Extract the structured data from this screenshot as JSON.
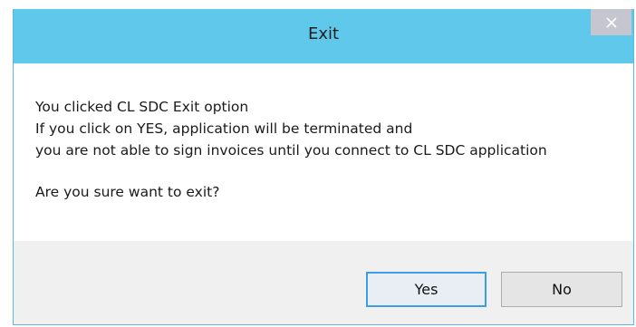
{
  "window": {
    "title": "Exit",
    "close_symbol": "close-icon"
  },
  "message": {
    "line1": "You clicked CL SDC Exit option",
    "line2": "If you click on YES, application will be terminated and",
    "line3": "you are not able to sign invoices until you connect to CL SDC application",
    "question": "Are you sure want to exit?"
  },
  "buttons": {
    "yes_label": "Yes",
    "no_label": "No"
  },
  "colors": {
    "titlebar": "#60c8eb",
    "close_button": "#c6c6d0",
    "focus_border": "#3c9ee6",
    "footer": "#f0f0f0"
  }
}
